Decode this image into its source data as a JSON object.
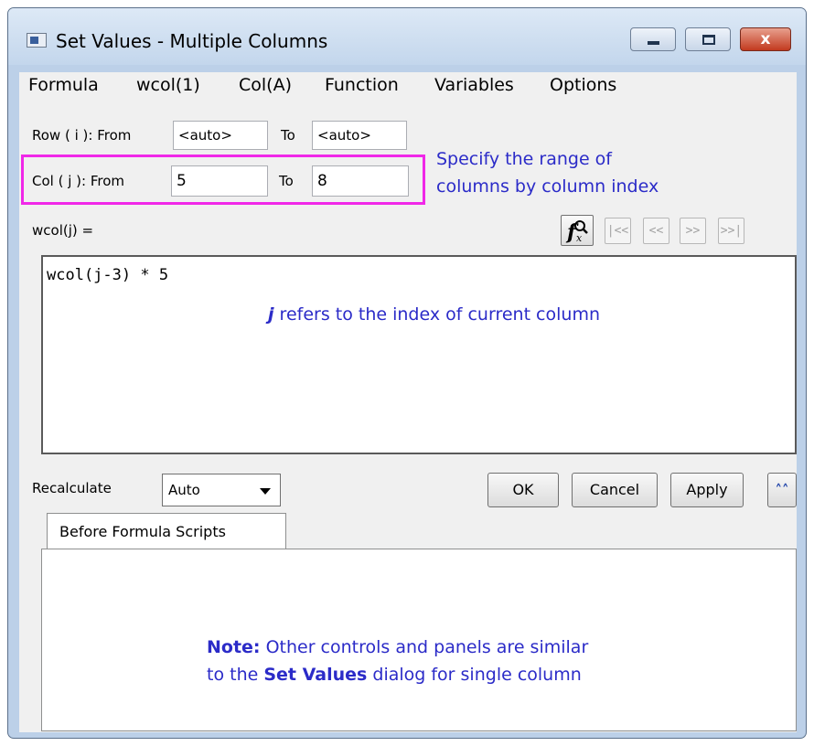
{
  "window": {
    "title": "Set Values - Multiple Columns",
    "close_glyph": "x",
    "icons": {
      "app": "app-window-icon",
      "minimize": "minimize-icon",
      "maximize": "maximize-icon",
      "close": "close-icon"
    }
  },
  "menu": [
    "Formula",
    "wcol(1)",
    "Col(A)",
    "Function",
    "Variables",
    "Options"
  ],
  "range": {
    "row": {
      "label": "Row ( i ):  From",
      "from_value": "<auto>",
      "to_label": "To",
      "to_value": "<auto>"
    },
    "col": {
      "label": "Col  ( j ):  From",
      "from_value": "5",
      "to_label": "To",
      "to_value": "8"
    }
  },
  "annotations": {
    "range_hint_line1": "Specify the range of",
    "range_hint_line2": "columns by column index",
    "editor_hint_var": "j",
    "editor_hint_text": " refers to the index of current column",
    "note_label": "Note:",
    "note_text_1": " Other controls and panels are similar",
    "note_text_2a": "to the ",
    "note_emph": "Set Values",
    "note_text_2b": " dialog for single column",
    "highlight_color": "#f028e8",
    "annotation_color": "#2b2bc8"
  },
  "formula": {
    "label": "wcol(j) =",
    "expression": "wcol(j-3) * 5",
    "toolbar": {
      "fx_icon": "function-wizard-icon",
      "first": "|<<",
      "prev": "<<",
      "next": ">>",
      "last": ">>|"
    }
  },
  "recalculate": {
    "label": "Recalculate",
    "value": "Auto"
  },
  "buttons": {
    "ok": "OK",
    "cancel": "Cancel",
    "apply": "Apply",
    "collapse": "˄˄",
    "collapse_icon": "double-chevron-up-icon"
  },
  "tabs": {
    "before_formula": "Before Formula Scripts"
  }
}
